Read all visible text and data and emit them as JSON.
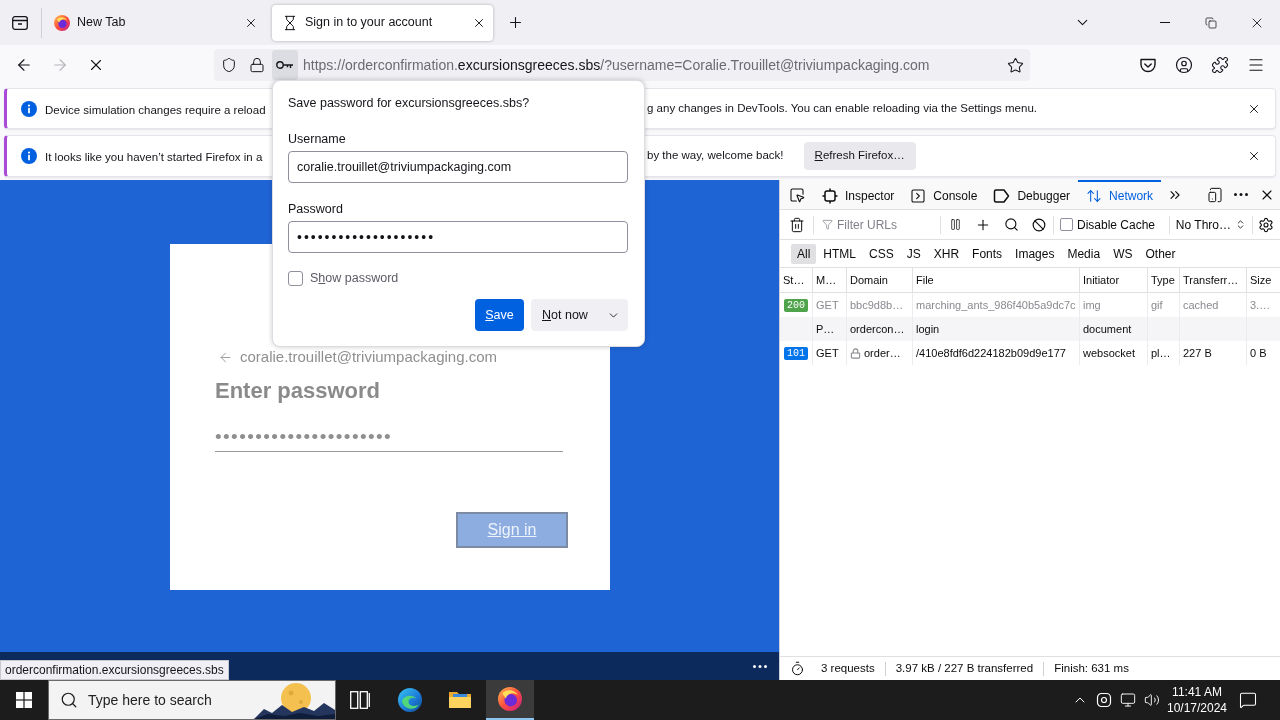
{
  "browser": {
    "tabs": [
      {
        "title": "New Tab",
        "kind": "firefox",
        "selected": false
      },
      {
        "title": "Sign in to your account",
        "kind": "loading",
        "selected": true
      }
    ],
    "nav_buttons": [
      {
        "kind": "back",
        "disabled": false
      },
      {
        "kind": "forward",
        "disabled": true
      },
      {
        "kind": "stop",
        "disabled": false
      }
    ],
    "url": {
      "scheme_host": "https://orderconfirmation.",
      "domain": "excursionsgreeces.sbs",
      "rest": "/?username=Coralie.Trouillet@triviumpackaging.com"
    }
  },
  "notifications": [
    {
      "text_start": "Device simulation changes require a reload",
      "text_end": "g any changes in DevTools. You can enable reloading via the Settings menu."
    },
    {
      "text_start": "It looks like you haven’t started Firefox in a",
      "text_end": "by the way, welcome back!",
      "button": {
        "accesskey": "R",
        "label_end": "efresh Firefox…"
      }
    }
  ],
  "save_password_popup": {
    "title": "Save password for excursionsgreeces.sbs?",
    "username": {
      "label": "Username",
      "value": "coralie.trouillet@triviumpackaging.com"
    },
    "password": {
      "label": "Password",
      "value": "••••••••••••••••••••"
    },
    "show_password": {
      "label_start": "S",
      "accesskey": "h",
      "label_end": "ow password",
      "checked": false
    },
    "buttons": [
      {
        "kind": "primary",
        "accesskey": "S",
        "label_end": "ave"
      },
      {
        "kind": "split",
        "accesskey": "N",
        "label_end": "ot now"
      }
    ]
  },
  "page": {
    "account": "coralie.trouillet@triviumpackaging.com",
    "heading": "Enter password",
    "password": "••••••••••••••••••••••",
    "sign_in": "Sign in",
    "link_status": "orderconfirmation.excursionsgreeces.sbs"
  },
  "devtools": {
    "tools": [
      {
        "kind": "inspector",
        "label": "Inspector",
        "selected": false
      },
      {
        "kind": "console",
        "label": "Console",
        "selected": false
      },
      {
        "kind": "debugger",
        "label": "Debugger",
        "selected": false
      },
      {
        "kind": "network",
        "label": "Network",
        "selected": true
      }
    ],
    "filter_placeholder": "Filter URLs",
    "disable_cache": {
      "label": "Disable Cache",
      "checked": false
    },
    "throttling": "No Thro…",
    "type_filters": [
      {
        "label": "All",
        "selected": true
      },
      {
        "label": "HTML",
        "selected": false
      },
      {
        "label": "CSS",
        "selected": false
      },
      {
        "label": "JS",
        "selected": false
      },
      {
        "label": "XHR",
        "selected": false
      },
      {
        "label": "Fonts",
        "selected": false
      },
      {
        "label": "Images",
        "selected": false
      },
      {
        "label": "Media",
        "selected": false
      },
      {
        "label": "WS",
        "selected": false
      },
      {
        "label": "Other",
        "selected": false
      }
    ],
    "columns": [
      "St…",
      "M…",
      "Domain",
      "File",
      "Initiator",
      "Type",
      "Transferr…",
      "Size"
    ],
    "rows": [
      {
        "status": "200",
        "color": "#4fa34b",
        "method": "GET",
        "domain": "bbc9d8b…",
        "secure": false,
        "file": "marching_ants_986f40b5a9dc7c",
        "initiator": "img",
        "type": "gif",
        "transferred": "cached",
        "size": "3.…",
        "cached": true
      },
      {
        "method": "P…",
        "domain": "ordercon…",
        "secure": false,
        "file": "login",
        "initiator": "document",
        "cached": false
      },
      {
        "status": "101",
        "color": "#0074e8",
        "method": "GET",
        "domain": "order…",
        "secure": true,
        "file": "/410e8fdf6d224182b09d9e177",
        "initiator": "websocket",
        "type": "pl…",
        "transferred": "227 B",
        "size": "0 B",
        "cached": false
      }
    ],
    "summary": [
      "3 requests",
      "3.97 kB / 227 B transferred",
      "Finish: 631 ms"
    ]
  },
  "taskbar": {
    "search_placeholder": "Type here to search",
    "apps": [
      {
        "kind": "task_view",
        "selected": false
      },
      {
        "kind": "edge",
        "selected": false
      },
      {
        "kind": "explorer",
        "selected": false
      },
      {
        "kind": "firefox",
        "selected": true
      }
    ],
    "time": "11:41 AM",
    "date": "10/17/2024"
  }
}
